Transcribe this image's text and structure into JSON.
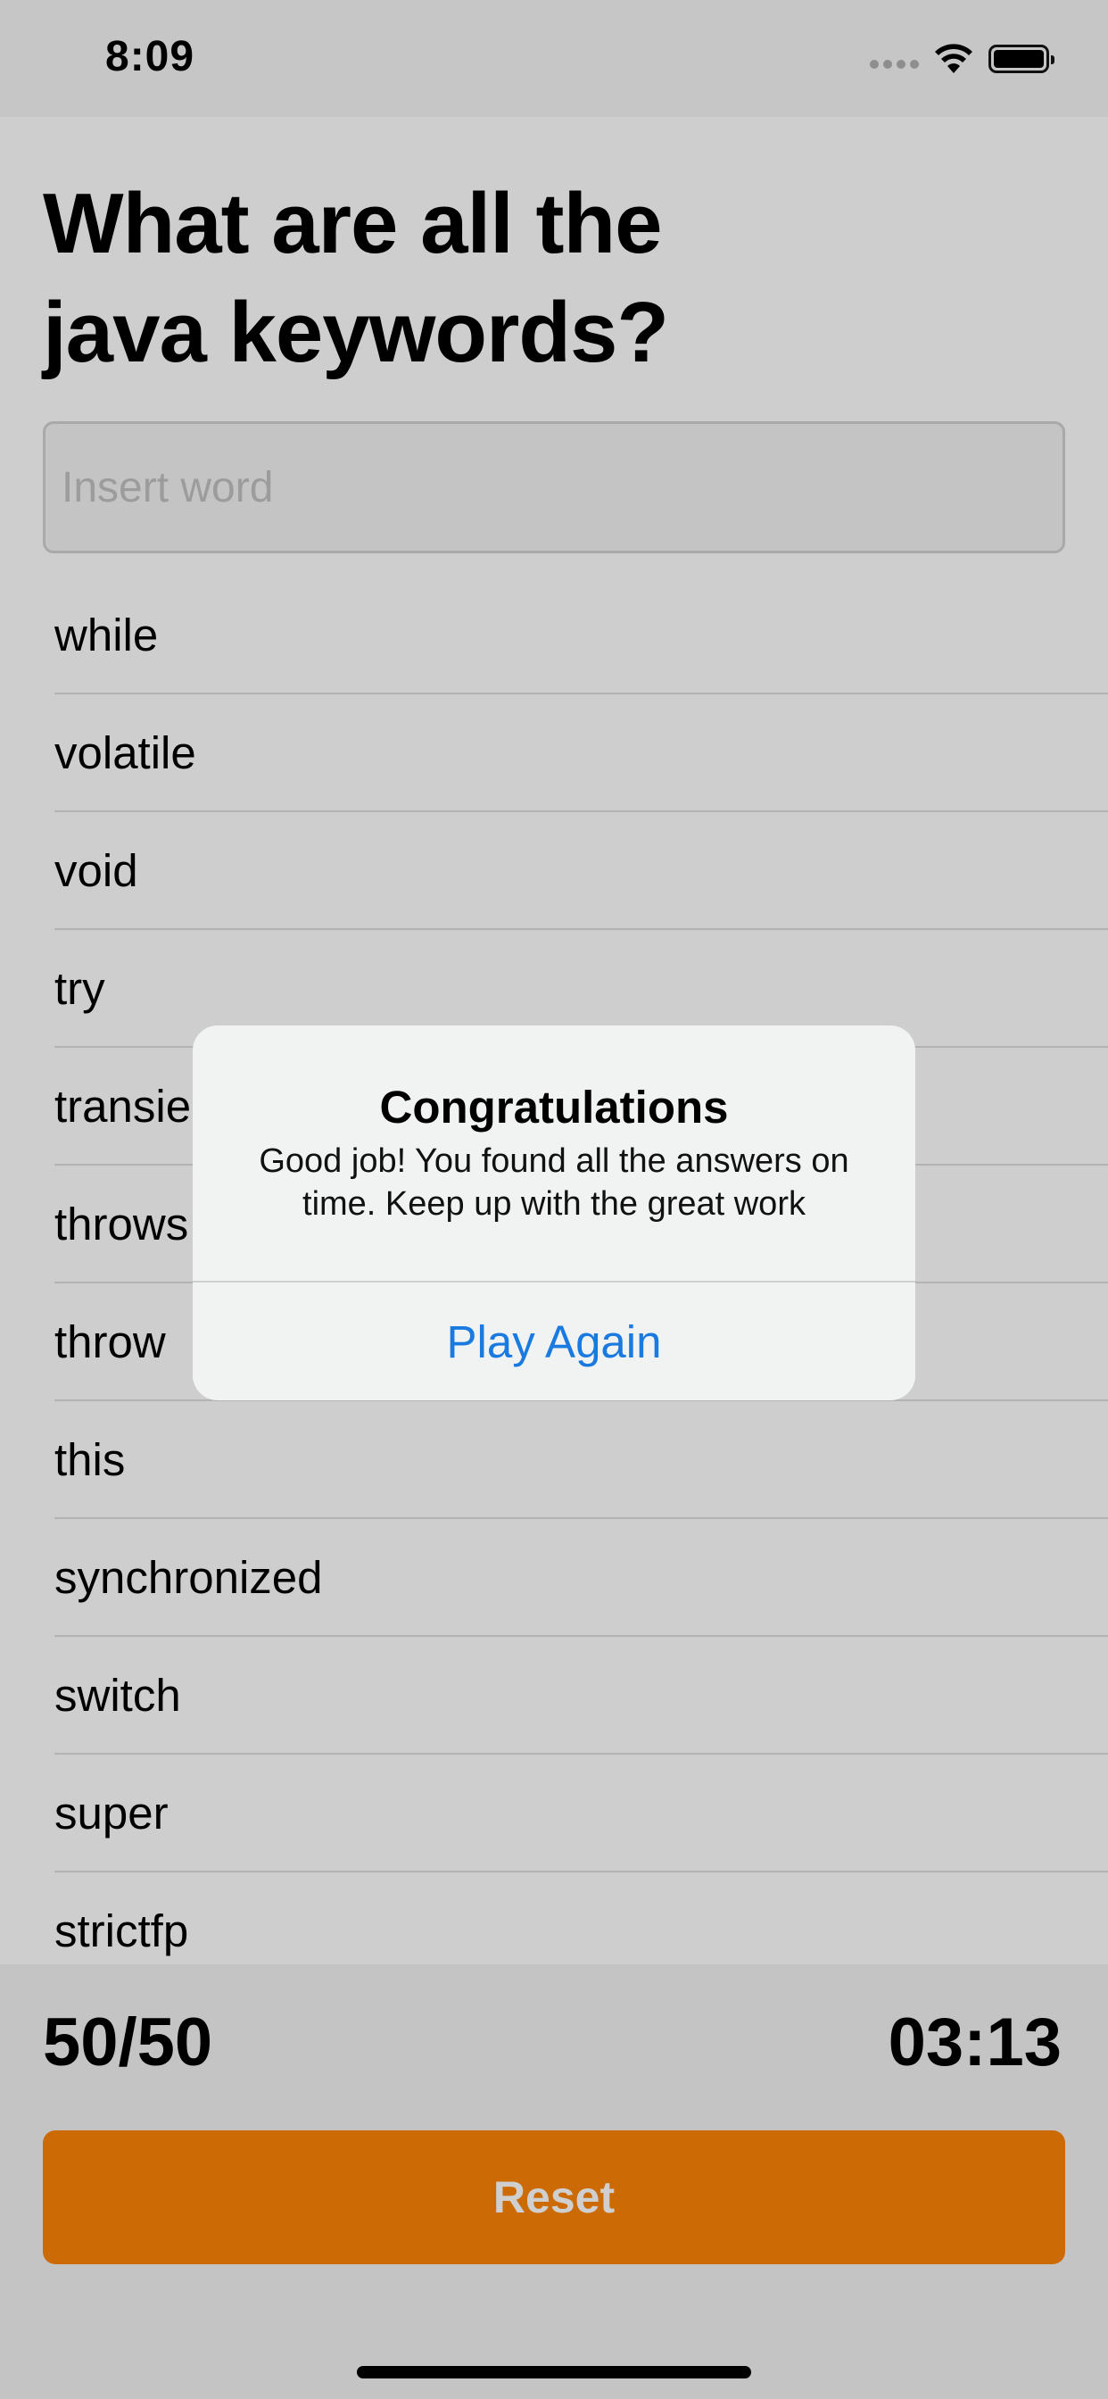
{
  "status_bar": {
    "time": "8:09",
    "icons": [
      "signal-dots-icon",
      "wifi-icon",
      "battery-icon"
    ]
  },
  "question": "What are all the java keywords?",
  "input": {
    "placeholder": "Insert word",
    "value": ""
  },
  "words": [
    "while",
    "volatile",
    "void",
    "try",
    "transient",
    "throws",
    "throw",
    "this",
    "synchronized",
    "switch",
    "super",
    "strictfp"
  ],
  "score": "50/50",
  "timer": "03:13",
  "reset_label": "Reset",
  "alert": {
    "title": "Congratulations",
    "message": "Good job! You found all the answers on time. Keep up with the great work",
    "action_label": "Play Again"
  },
  "colors": {
    "accent": "#cc6a06",
    "link": "#1a7ae0"
  }
}
